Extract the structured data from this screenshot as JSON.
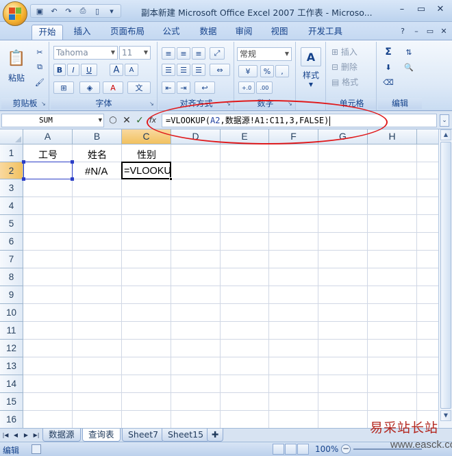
{
  "window": {
    "title": "副本新建 Microsoft Office Excel 2007 工作表 - Microso...",
    "minimize_glyph": "–",
    "restore_glyph": "▭",
    "close_glyph": "✕"
  },
  "quick_access": {
    "save_icon": "floppy-save-icon",
    "undo_icon": "undo-icon",
    "redo_icon": "redo-icon",
    "print_preview_icon": "print-preview-icon",
    "new_icon": "new-document-icon"
  },
  "ribbon_tabs": [
    "开始",
    "插入",
    "页面布局",
    "公式",
    "数据",
    "审阅",
    "视图",
    "开发工具"
  ],
  "active_tab": "开始",
  "ribbon": {
    "clipboard": {
      "paste": "粘贴",
      "label": "剪贴板"
    },
    "font": {
      "font_name": "Tahoma",
      "font_size": "11",
      "bold": "B",
      "italic": "I",
      "underline": "U",
      "grow": "A",
      "shrink": "A",
      "label": "字体"
    },
    "alignment": {
      "label": "对齐方式"
    },
    "number": {
      "format": "常规",
      "percent": "%",
      "comma": ",",
      "inc_decimal": "+.0\n.00",
      "dec_decimal": ".00\n+.0",
      "label": "数字"
    },
    "styles": {
      "button": "样式"
    },
    "cells": {
      "insert": "插入",
      "delete": "删除",
      "format": "格式",
      "label": "单元格"
    },
    "editing": {
      "sum": "Σ",
      "label": "编辑"
    }
  },
  "formula_bar": {
    "name_box": "SUM",
    "cancel": "✕",
    "enter": "✓",
    "fx": "fx",
    "formula_prefix": "=VLOOKUP(",
    "formula_ref": "A2",
    "formula_rest": ",数据源!A1:C11,3,FALSE)"
  },
  "columns": [
    "A",
    "B",
    "C",
    "D",
    "E",
    "F",
    "G",
    "H"
  ],
  "rows": [
    "1",
    "2",
    "3",
    "4",
    "5",
    "6",
    "7",
    "8",
    "9",
    "10",
    "11",
    "12",
    "13",
    "14",
    "15",
    "16"
  ],
  "cells": {
    "A1": "工号",
    "B1": "姓名",
    "C1": "性别",
    "B2": "#N/A",
    "C2": "=VLOOKU"
  },
  "sheet_tabs": [
    "数据源",
    "查询表",
    "Sheet7",
    "Sheet15"
  ],
  "active_sheet": "查询表",
  "status": {
    "mode": "编辑",
    "zoom": "100%"
  },
  "watermark": {
    "text": "易采站长站",
    "url": "www.easck.com"
  },
  "colors": {
    "accent": "#15428b",
    "highlight_ellipse": "#e0191b",
    "selection_border": "#2b3ec7",
    "active_header": "#f1c15f"
  }
}
